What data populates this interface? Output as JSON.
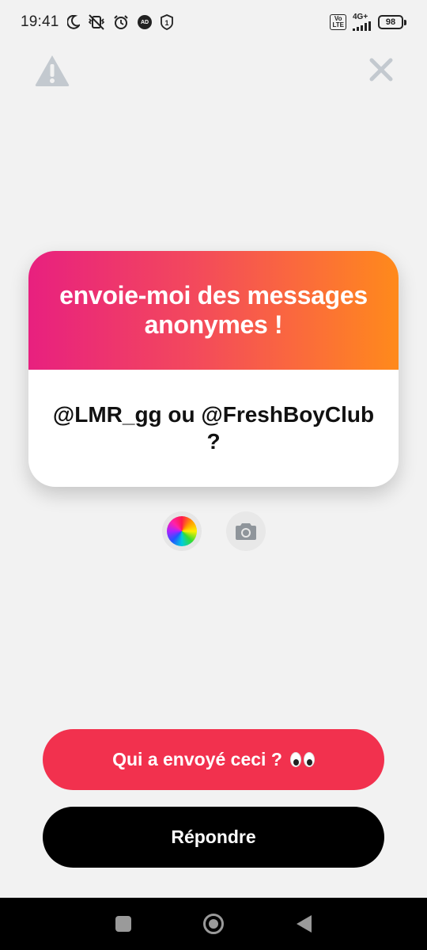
{
  "status_bar": {
    "time": "19:41",
    "volte_label": "Vo\nLTE",
    "network_label": "4G+",
    "battery_level": "98",
    "icons": [
      "moon-icon",
      "vibrate-off-icon",
      "alarm-icon",
      "ad-icon",
      "sim-1-icon",
      "volte-icon",
      "signal-icon",
      "battery-icon"
    ]
  },
  "top_actions": {
    "report_icon": "warning-icon",
    "close_icon": "close-icon"
  },
  "card": {
    "title": "envoie-moi des messages anonymes !",
    "question": "@LMR_gg ou @FreshBoyClub ?",
    "gradient_colors": [
      "#e8207f",
      "#ff8a1b"
    ]
  },
  "controls": {
    "color_icon": "color-wheel-icon",
    "camera_icon": "camera-icon"
  },
  "buttons": {
    "who_sent": "Qui a envoyé ceci ?",
    "who_sent_emoji": "eyes-emoji",
    "reply": "Répondre",
    "who_sent_color": "#f2314e",
    "reply_color": "#000000"
  },
  "nav_bar": {
    "icons": [
      "recents-icon",
      "home-icon",
      "back-icon"
    ]
  }
}
